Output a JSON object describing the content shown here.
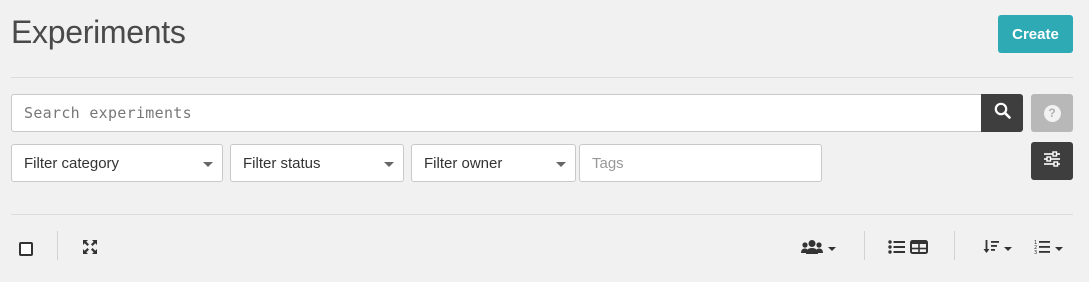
{
  "header": {
    "title": "Experiments",
    "create_label": "Create"
  },
  "search": {
    "placeholder": "Search experiments",
    "value": "",
    "search_icon": "search-icon",
    "help_icon": "question-circle-icon",
    "help_glyph": "?"
  },
  "filters": {
    "category": "Filter category",
    "status": "Filter status",
    "owner": "Filter owner",
    "tags_placeholder": "Tags",
    "advanced_icon": "sliders-icon"
  },
  "toolbar": {
    "select_all_icon": "checkbox-icon",
    "expand_icon": "expand-arrows-icon",
    "users_icon": "users-icon",
    "list_view_icon": "list-icon",
    "table_view_icon": "table-icon",
    "sort_icon": "sort-amount-down-icon",
    "order_icon": "ordered-list-icon"
  },
  "colors": {
    "accent": "#2eaab4",
    "dark_button": "#3e3e3e",
    "disabled_button": "#b8b8b8",
    "background": "#f1f1f1"
  }
}
